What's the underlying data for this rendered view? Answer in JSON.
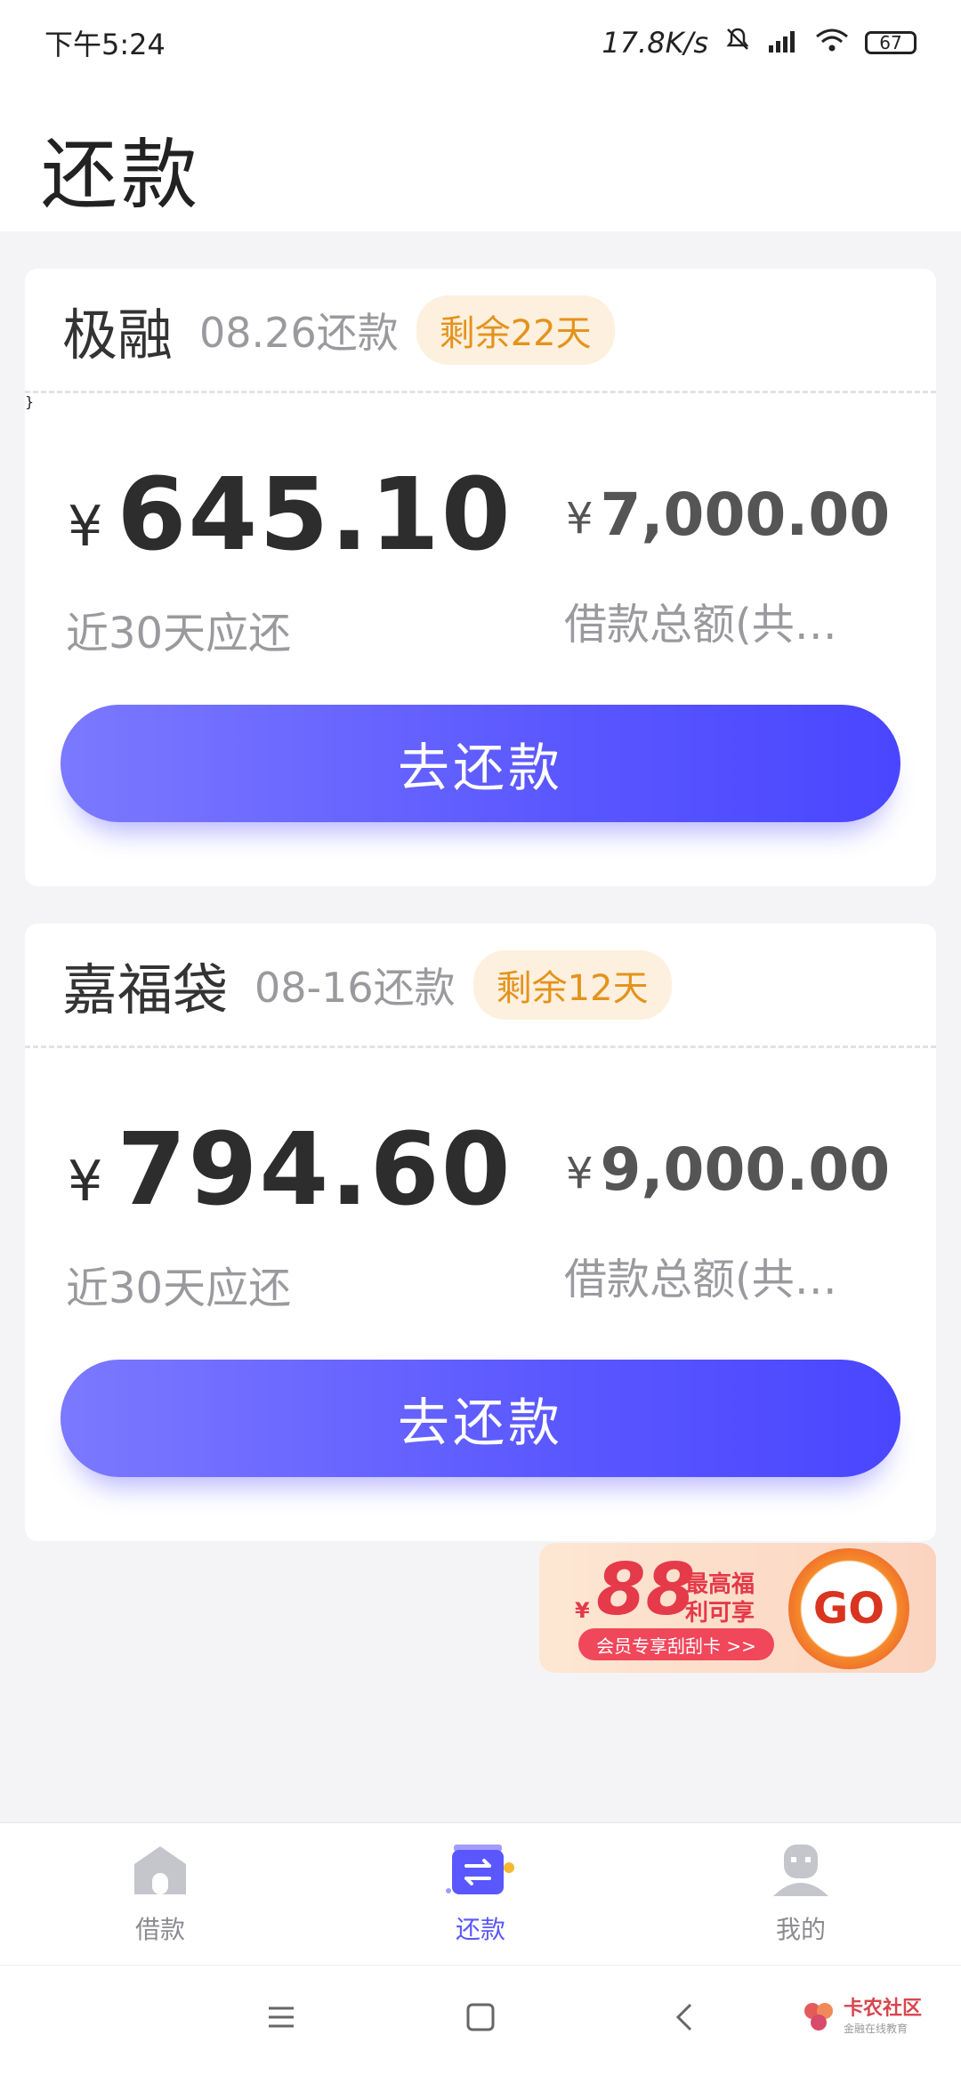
{
  "status": {
    "time": "下午5:24",
    "speed": "17.8K/s",
    "battery": "67"
  },
  "header": {
    "title": "还款"
  },
  "loans": [
    {
      "name": "极融",
      "due": "08.26还款",
      "remaining": "剩余22天",
      "currency": "¥",
      "amount": "645.10",
      "amount_label": "近30天应还",
      "total": "7,000.00",
      "total_label": "借款总额(共…",
      "button": "去还款"
    },
    {
      "name": "嘉福袋",
      "due": "08-16还款",
      "remaining": "剩余12天",
      "currency": "¥",
      "amount": "794.60",
      "amount_label": "近30天应还",
      "total": "9,000.00",
      "total_label": "借款总额(共…",
      "button": "去还款"
    }
  ],
  "promo": {
    "currency": "¥",
    "value": "88",
    "line1": "最高福",
    "line2": "利可享",
    "pill": "会员专享刮刮卡 >>",
    "go": "GO"
  },
  "tabs": [
    {
      "label": "借款",
      "icon": "house-icon"
    },
    {
      "label": "还款",
      "icon": "wallet-icon"
    },
    {
      "label": "我的",
      "icon": "profile-icon"
    }
  ],
  "watermark": {
    "title": "卡农社区",
    "subtitle": "金融在线教育"
  },
  "colors": {
    "accent": "#5a57ff",
    "badge_text": "#e4931d",
    "badge_bg": "#fdf0de",
    "promo_red": "#e53a4a"
  }
}
